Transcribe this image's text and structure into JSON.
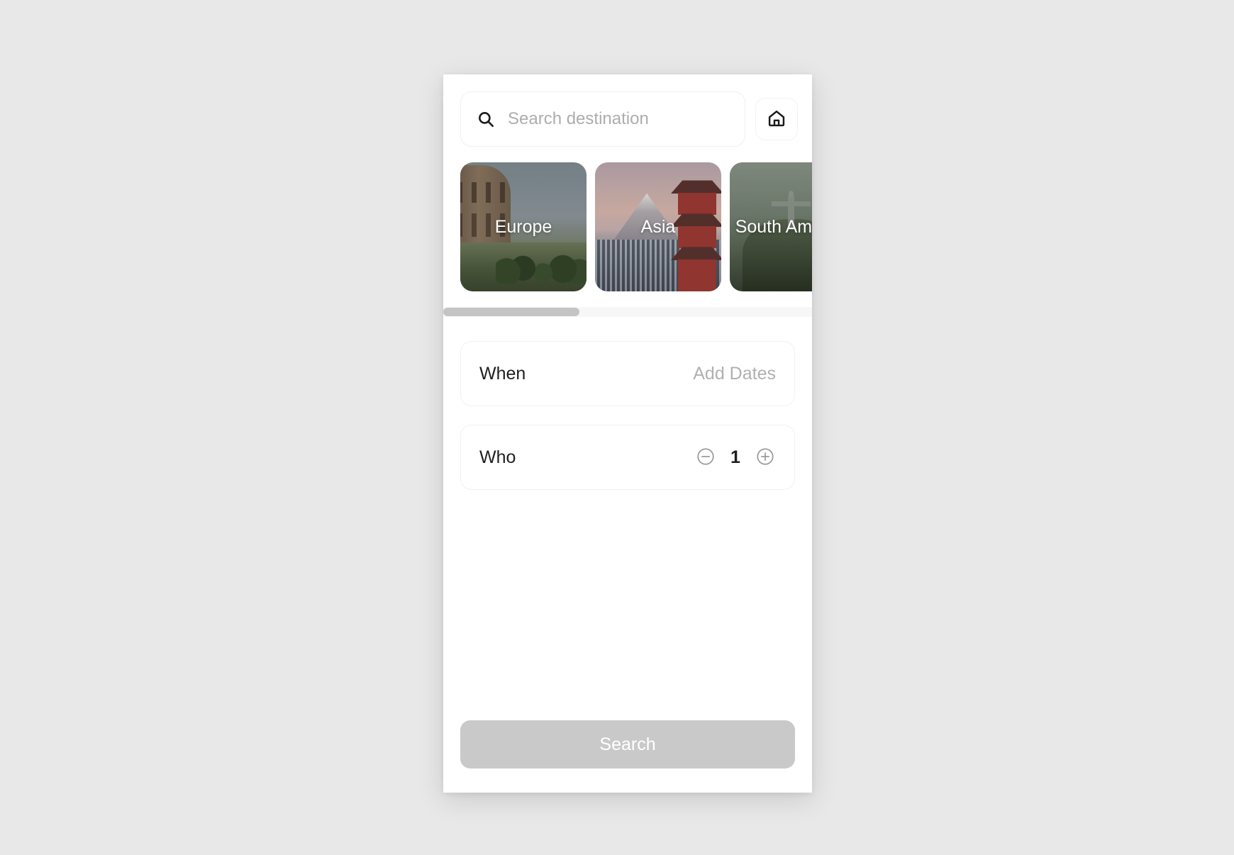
{
  "search": {
    "placeholder": "Search destination",
    "value": "",
    "icon": "search-icon",
    "home_button_icon": "home-icon"
  },
  "destinations": {
    "items": [
      {
        "label": "Europe",
        "art": "colosseum"
      },
      {
        "label": "Asia",
        "art": "mount-fuji-pagoda"
      },
      {
        "label": "South America",
        "art": "corcovado"
      }
    ],
    "scrollbar": {
      "thumb_percent": 37
    }
  },
  "options": [
    {
      "label": "When",
      "value": "Add Dates",
      "type": "text"
    },
    {
      "label": "Who",
      "value": "1",
      "type": "stepper",
      "decrement_icon": "minus-circle-icon",
      "increment_icon": "plus-circle-icon"
    }
  ],
  "footer": {
    "search_label": "Search"
  },
  "colors": {
    "page_background": "#e8e8e8",
    "panel_background": "#ffffff",
    "text_primary": "#1f1f1f",
    "text_muted": "#b0b0b0",
    "button_disabled": "#c9c9c9",
    "scrollbar_thumb": "#c4c4c4"
  }
}
